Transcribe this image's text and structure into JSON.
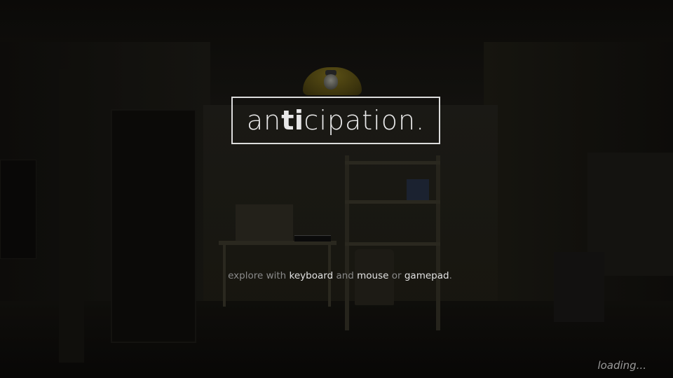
{
  "title": {
    "prefix": "an",
    "emphasis": "ti",
    "suffix": "cipation."
  },
  "instructions": {
    "part1": "explore with ",
    "keyboard": "keyboard",
    "part2": " and ",
    "mouse": "mouse",
    "part3": " or ",
    "gamepad": "gamepad",
    "part4": "."
  },
  "status": {
    "loading": "loading..."
  },
  "colors": {
    "background": "#0e0d0b",
    "title_border": "#dcdcdc",
    "highlight_text": "#e2e2e2",
    "dim_text": "#8a8a8a",
    "lamp": "#5b5015"
  }
}
